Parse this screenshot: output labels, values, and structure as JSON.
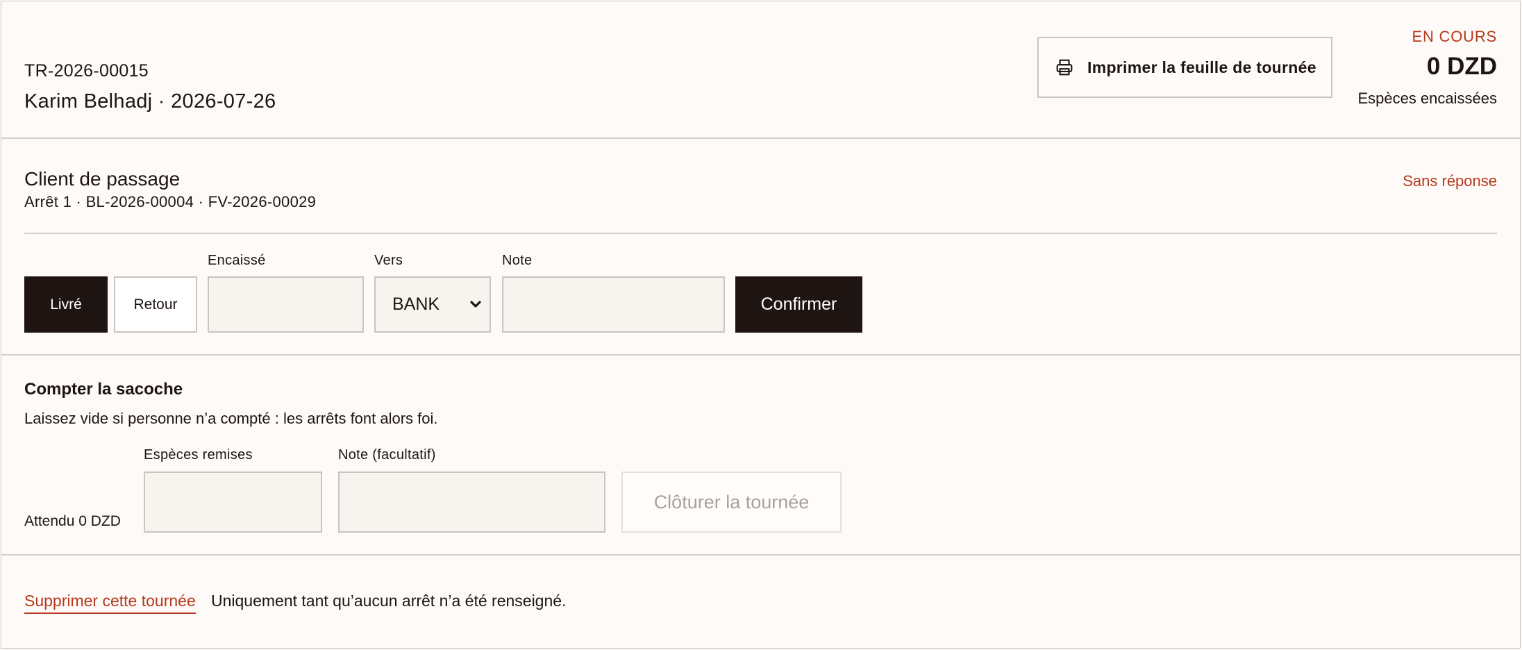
{
  "header": {
    "reference": "TR-2026-00015",
    "driver_line": "Karim Belhadj · 2026-07-26",
    "print_label": "Imprimer la feuille de tournée",
    "status": "EN COURS",
    "amount": "0 DZD",
    "amount_label": "Espèces encaissées"
  },
  "stop": {
    "client": "Client de passage",
    "meta": "Arrêt 1 · BL-2026-00004 · FV-2026-00029",
    "status": "Sans réponse",
    "delivered_label": "Livré",
    "return_label": "Retour",
    "collected_label": "Encaissé",
    "collected_value": "",
    "to_label": "Vers",
    "to_value": "BANK",
    "note_label": "Note",
    "note_value": "",
    "confirm_label": "Confirmer"
  },
  "bag": {
    "title": "Compter la sacoche",
    "hint": "Laissez vide si personne n’a compté : les arrêts font alors foi.",
    "expected": "Attendu 0 DZD",
    "cash_label": "Espèces remises",
    "cash_value": "",
    "note_label": "Note (facultatif)",
    "note_value": "",
    "close_label": "Clôturer la tournée"
  },
  "footer": {
    "delete_label": "Supprimer cette tournée",
    "delete_hint": "Uniquement tant qu’aucun arrêt n’a été renseigné."
  },
  "colors": {
    "accent": "#b6391d",
    "dark": "#1e1512",
    "background": "#fdfaf8",
    "input_bg": "#f7f3ee"
  },
  "icons": {
    "print": "printer-icon",
    "select": "chevron-down-icon"
  }
}
